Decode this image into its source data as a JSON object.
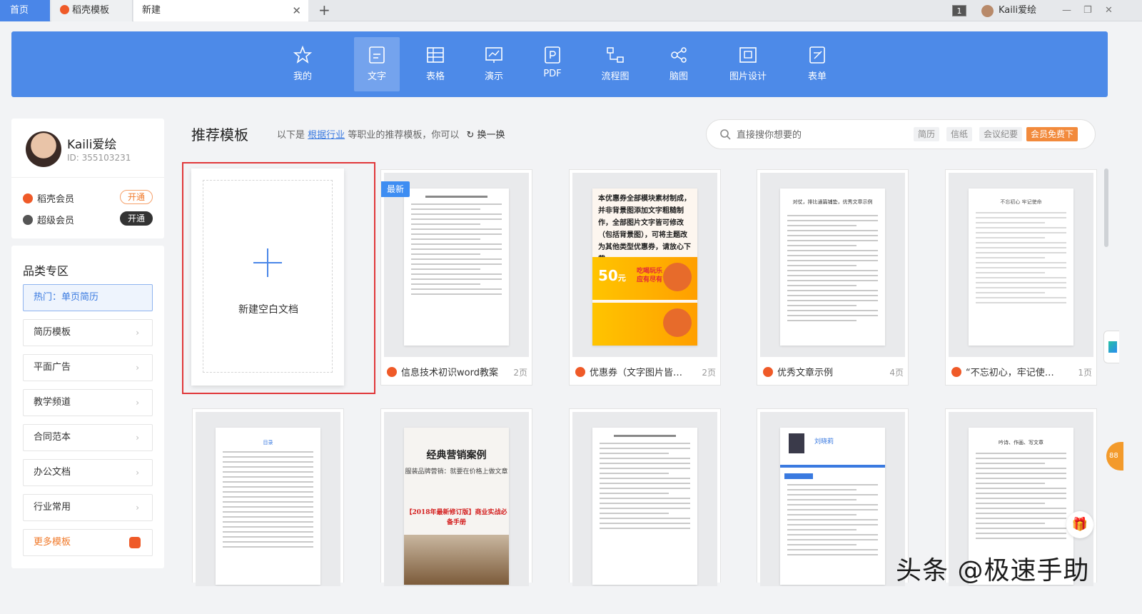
{
  "tabs": [
    {
      "label": "首页"
    },
    {
      "label": "稻壳模板"
    },
    {
      "label": "新建"
    }
  ],
  "titlebar": {
    "badge": "1",
    "username": "Kaili爱绘"
  },
  "toolbar": {
    "items": [
      {
        "label": "我的",
        "icon": "star-icon"
      },
      {
        "label": "文字",
        "icon": "document-icon",
        "active": true
      },
      {
        "label": "表格",
        "icon": "table-icon"
      },
      {
        "label": "演示",
        "icon": "presentation-icon"
      },
      {
        "label": "PDF",
        "icon": "pdf-icon"
      },
      {
        "label": "流程图",
        "icon": "flowchart-icon"
      },
      {
        "label": "脑图",
        "icon": "mindmap-icon"
      },
      {
        "label": "图片设计",
        "icon": "image-design-icon"
      },
      {
        "label": "表单",
        "icon": "form-icon"
      }
    ]
  },
  "user": {
    "name": "Kaili爱绘",
    "id": "ID: 355103231",
    "memberships": [
      {
        "label": "稻壳会员",
        "button": "开通"
      },
      {
        "label": "超级会员",
        "button": "开通"
      }
    ]
  },
  "categories": {
    "title": "品类专区",
    "items": [
      {
        "label": "热门：单页简历",
        "active": true
      },
      {
        "label": "简历模板"
      },
      {
        "label": "平面广告"
      },
      {
        "label": "教学频道"
      },
      {
        "label": "合同范本"
      },
      {
        "label": "办公文档"
      },
      {
        "label": "行业常用"
      },
      {
        "label": "更多模板"
      }
    ]
  },
  "recommend": {
    "title": "推荐模板",
    "desc_prefix": "以下是",
    "desc_link": "根据行业",
    "desc_suffix": "等职业的推荐模板，你可以",
    "refresh": "换一换"
  },
  "search": {
    "placeholder": "直接搜你想要的",
    "tags": [
      "简历",
      "信纸",
      "会议纪要"
    ],
    "vip": "会员免费下"
  },
  "blank": {
    "label": "新建空白文档"
  },
  "cards": [
    {
      "name": "信息技术初识word教案",
      "pages": "2页",
      "badge": "最新"
    },
    {
      "name": "优惠券（文字图片皆…",
      "pages": "2页"
    },
    {
      "name": "优秀文章示例",
      "pages": "4页"
    },
    {
      "name": "“不忘初心，牢记使…",
      "pages": "1页"
    }
  ],
  "previews": {
    "coupon_text": "本优惠券全部模块素材制成，并非背景图添加文字粗糙制作，全部图片文字皆可修改（包括背景图），可将主题改为其他类型优惠券，请放心下载。",
    "coupon_num": "50",
    "coupon_num_unit": "元",
    "coupon_slogan": "吃喝玩乐 应有尽有",
    "marketing_title": "经典营销案例",
    "marketing_sub": "服装品牌营销：就要在价格上做文章",
    "marketing_red": "【2018年最新修订版】商业实战必备手册",
    "resume_name": "刘晓莉",
    "article_title": "对仗，排比通篇铺垫，优秀文章示例",
    "oath_title": "不忘初心  牢记使命",
    "toc_title": "目录",
    "essay_title": "吟诗、作画、写文章"
  },
  "side": {
    "badge": "88"
  },
  "watermark": "头条 @极速手助",
  "colors": {
    "brand_blue": "#4d8ae8",
    "accent_orange": "#f07a2b",
    "highlight_red": "#e0373a"
  }
}
